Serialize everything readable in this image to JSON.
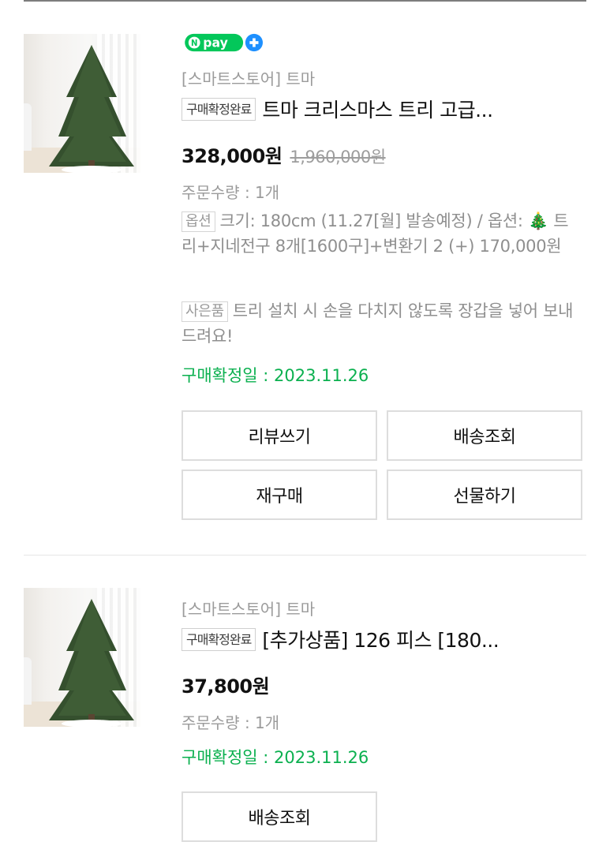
{
  "orders": [
    {
      "npay_label": "pay",
      "store": "[스마트스토어] 트마",
      "badge": "구매확정완료",
      "title": "트마 크리스마스 트리 고급...",
      "price": "328,000원",
      "original_price": "1,960,000원",
      "quantity": "주문수량 : 1개",
      "option_tag": "옵션",
      "option_text": "크기: 180cm (11.27[월] 발송예정) / 옵션: 🎄 트리+지네전구 8개[1600구]+변환기 2 (+) 170,000원",
      "gift_tag": "사은품",
      "gift_text": "트리 설치 시 손을 다치지 않도록 장갑을 넣어 보내드려요!",
      "confirm_date": "구매확정일 : 2023.11.26",
      "buttons": {
        "review": "리뷰쓰기",
        "tracking": "배송조회",
        "reorder": "재구매",
        "gift": "선물하기"
      }
    },
    {
      "store": "[스마트스토어] 트마",
      "badge": "구매확정완료",
      "title": "[추가상품] 126 피스 [180...",
      "price": "37,800원",
      "quantity": "주문수량 : 1개",
      "confirm_date": "구매확정일 : 2023.11.26",
      "buttons": {
        "tracking": "배송조회"
      }
    }
  ],
  "colors": {
    "confirm_green": "#0bb04f",
    "npay_green": "#03c75a",
    "npay_plus_blue": "#1e90ff"
  }
}
